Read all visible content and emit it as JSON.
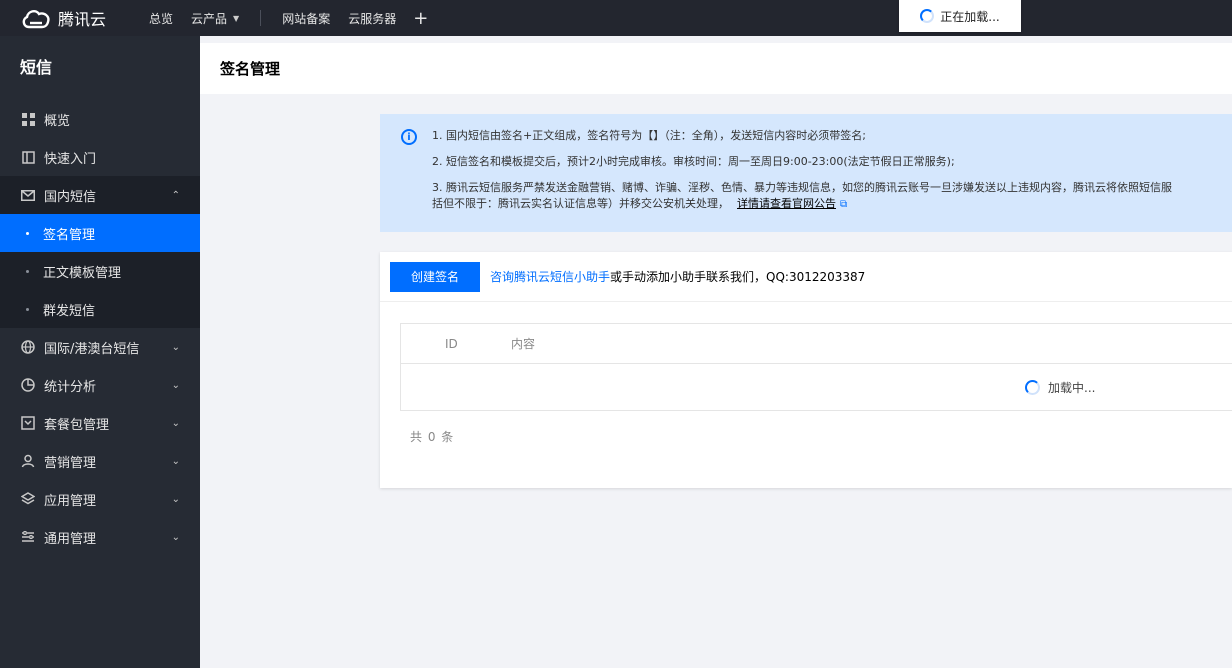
{
  "topbar": {
    "brand": "腾讯云",
    "nav": [
      {
        "label": "总览"
      },
      {
        "label": "云产品",
        "has_caret": true
      },
      {
        "label": "网站备案"
      },
      {
        "label": "云服务器"
      }
    ],
    "plus": "+",
    "loading": "正在加载..."
  },
  "sidebar": {
    "title": "短信",
    "items": {
      "overview": "概览",
      "quickstart": "快速入门",
      "domestic": "国内短信",
      "sign_mgmt": "签名管理",
      "template_mgmt": "正文模板管理",
      "bulk_sms": "群发短信",
      "international": "国际/港澳台短信",
      "stats": "统计分析",
      "package": "套餐包管理",
      "marketing": "营销管理",
      "app_mgmt": "应用管理",
      "general": "通用管理"
    }
  },
  "page": {
    "title": "签名管理"
  },
  "notice": {
    "line1": "1. 国内短信由签名+正文组成，签名符号为【】（注：全角），发送短信内容时必须带签名;",
    "line2": "2. 短信签名和模板提交后，预计2小时完成审核。审核时间：周一至周日9:00-23:00(法定节假日正常服务);",
    "line3a": "3. 腾讯云短信服务严禁发送金融营销、赌博、诈骗、淫秽、色情、暴力等违规信息，如您的腾讯云账号一旦涉嫌发送以上违规内容，腾讯云将依照短信服",
    "line3b": "括但不限于：腾讯云实名认证信息等）并移交公安机关处理，",
    "link": "详情请查看官网公告"
  },
  "toolbar": {
    "create_label": "创建签名",
    "help_link": "咨询腾讯云短信小助手",
    "help_text": "或手动添加小助手联系我们，QQ:3012203387"
  },
  "table": {
    "columns": [
      "ID",
      "内容"
    ],
    "loading": "加载中..."
  },
  "pagination": {
    "total": "共 0 条"
  },
  "colors": {
    "accent": "#006eff",
    "topbar": "#23262f",
    "sidebar": "#262b34"
  }
}
